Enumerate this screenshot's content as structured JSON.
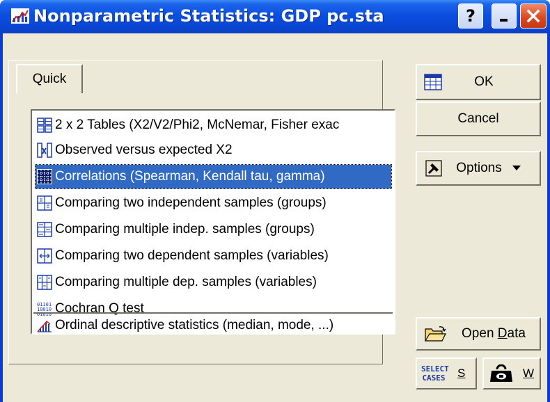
{
  "window": {
    "title": "Nonparametric Statistics: GDP pc.sta",
    "help_label": "?",
    "close_label": "✕"
  },
  "tabs": [
    {
      "label": "Quick",
      "active": true
    }
  ],
  "analysis_list": {
    "items": [
      {
        "label": "2 x 2 Tables (X2/V2/Phi2, McNemar, Fisher exac",
        "icon": "grid-2x2-icon",
        "selected": false
      },
      {
        "label": "Observed versus expected X2",
        "icon": "observed-expected-icon",
        "selected": false
      },
      {
        "label": "Correlations (Spearman, Kendall tau, gamma)",
        "icon": "correlation-matrix-icon",
        "selected": true
      },
      {
        "label": "Comparing two independent samples (groups)",
        "icon": "two-independent-icon",
        "selected": false
      },
      {
        "label": "Comparing multiple indep. samples (groups)",
        "icon": "multiple-independent-icon",
        "selected": false
      },
      {
        "label": "Comparing two dependent samples (variables)",
        "icon": "two-dependent-icon",
        "selected": false
      },
      {
        "label": "Comparing multiple dep. samples (variables)",
        "icon": "multiple-dependent-icon",
        "selected": false
      },
      {
        "label": "Cochran Q test",
        "icon": "binary-digits-icon",
        "selected": false
      },
      {
        "label": "Ordinal descriptive statistics (median, mode, ...)",
        "icon": "histogram-icon",
        "selected": false
      }
    ]
  },
  "buttons": {
    "ok": "OK",
    "cancel": "Cancel",
    "options": "Options",
    "open_data_prefix": "Open ",
    "open_data_hotkey": "D",
    "open_data_suffix": "ata",
    "select_cases_line1": "SELECT",
    "select_cases_line2": "CASES",
    "select_cases_hotkey": "S",
    "weight_hotkey": "W"
  },
  "colors": {
    "titlebar": "#0a4fe0",
    "selection": "#316ac5",
    "dialog_face": "#ece9d8",
    "close_button": "#d9461e"
  }
}
